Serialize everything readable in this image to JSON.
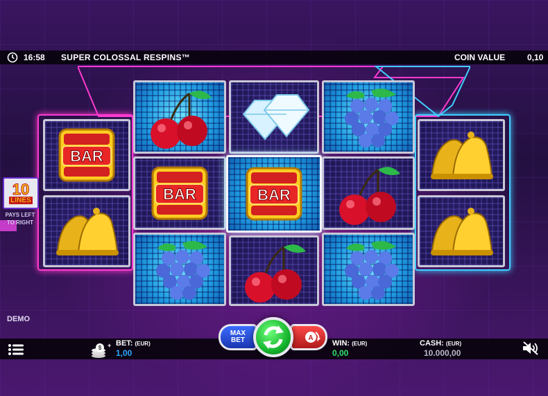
{
  "header": {
    "time": "16:58",
    "title": "SUPER COLOSSAL RESPINS™",
    "coin_value_label": "COIN VALUE",
    "coin_value": "0,10"
  },
  "paytable": {
    "lines_number": "10",
    "lines_label": "LINES",
    "pays_text": "PAYS LEFT TO RIGHT"
  },
  "mode_label": "DEMO",
  "bet": {
    "label": "BET:",
    "currency": "(EUR)",
    "value": "1,00"
  },
  "win": {
    "label": "WIN:",
    "currency": "(EUR)",
    "value": "0,00"
  },
  "cash": {
    "label": "CASH:",
    "currency": "(EUR)",
    "value": "10.000,00"
  },
  "buttons": {
    "max_bet_line1": "MAX",
    "max_bet_line2": "BET"
  },
  "reels": {
    "reel1": [
      "bar",
      "bell"
    ],
    "reel2": [
      "cherry",
      "bar",
      "grape"
    ],
    "reel3": [
      "diamond",
      "bar",
      "cherry"
    ],
    "reel4": [
      "grape",
      "cherry",
      "grape"
    ],
    "reel5": [
      "bell",
      "bell"
    ]
  },
  "bar_symbol_text": "BAR",
  "colors": {
    "bet_value": "#29a9ff",
    "win_value": "#2ee66e",
    "frame_pink": "#ff3ad0",
    "frame_cyan": "#3fd0ff"
  }
}
